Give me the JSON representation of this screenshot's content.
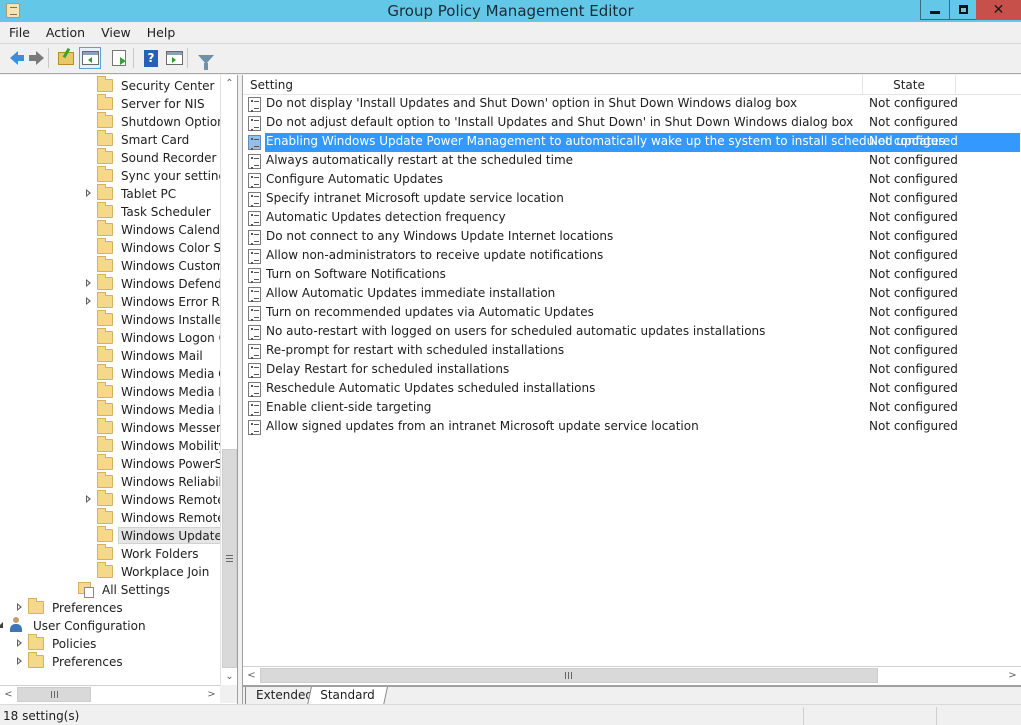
{
  "window": {
    "title": "Group Policy Management Editor",
    "minimize_label": "minimize",
    "restore_label": "restore",
    "close_glyph": "✕"
  },
  "menu": [
    "File",
    "Action",
    "View",
    "Help"
  ],
  "toolbar": {
    "buttons": [
      {
        "name": "back",
        "icon": "arrow-left-icon"
      },
      {
        "name": "forward",
        "icon": "arrow-right-icon"
      },
      {
        "name": "up-one-level",
        "icon": "folder-up-icon"
      },
      {
        "name": "show-hide-console-tree",
        "icon": "pane-icon",
        "active": true
      },
      {
        "name": "export-list",
        "icon": "export-icon"
      },
      {
        "name": "help",
        "icon": "help-icon"
      },
      {
        "name": "show-hide-action-pane",
        "icon": "pane-icon"
      },
      {
        "name": "filter",
        "icon": "filter-icon"
      }
    ],
    "help_glyph": "?"
  },
  "tree": {
    "items": [
      {
        "label": "Security Center",
        "level": 3,
        "expander": "none"
      },
      {
        "label": "Server for NIS",
        "level": 3,
        "expander": "none"
      },
      {
        "label": "Shutdown Options",
        "level": 3,
        "expander": "none"
      },
      {
        "label": "Smart Card",
        "level": 3,
        "expander": "none"
      },
      {
        "label": "Sound Recorder",
        "level": 3,
        "expander": "none"
      },
      {
        "label": "Sync your settings",
        "level": 3,
        "expander": "none"
      },
      {
        "label": "Tablet PC",
        "level": 3,
        "expander": "collapsed"
      },
      {
        "label": "Task Scheduler",
        "level": 3,
        "expander": "none"
      },
      {
        "label": "Windows Calendar",
        "level": 3,
        "expander": "none"
      },
      {
        "label": "Windows Color System",
        "level": 3,
        "expander": "none"
      },
      {
        "label": "Windows Customer Experience Improvement Program",
        "level": 3,
        "expander": "none"
      },
      {
        "label": "Windows Defender",
        "level": 3,
        "expander": "collapsed"
      },
      {
        "label": "Windows Error Reporting",
        "level": 3,
        "expander": "collapsed"
      },
      {
        "label": "Windows Installer",
        "level": 3,
        "expander": "none"
      },
      {
        "label": "Windows Logon Options",
        "level": 3,
        "expander": "none"
      },
      {
        "label": "Windows Mail",
        "level": 3,
        "expander": "none"
      },
      {
        "label": "Windows Media Center",
        "level": 3,
        "expander": "none"
      },
      {
        "label": "Windows Media Digital Rights Management",
        "level": 3,
        "expander": "none"
      },
      {
        "label": "Windows Media Player",
        "level": 3,
        "expander": "none"
      },
      {
        "label": "Windows Messenger",
        "level": 3,
        "expander": "none"
      },
      {
        "label": "Windows Mobility Center",
        "level": 3,
        "expander": "none"
      },
      {
        "label": "Windows PowerShell",
        "level": 3,
        "expander": "none"
      },
      {
        "label": "Windows Reliability Analysis",
        "level": 3,
        "expander": "none"
      },
      {
        "label": "Windows Remote Management (WinRM)",
        "level": 3,
        "expander": "collapsed"
      },
      {
        "label": "Windows Remote Shell",
        "level": 3,
        "expander": "none"
      },
      {
        "label": "Windows Update",
        "level": 3,
        "expander": "none",
        "selected": true
      },
      {
        "label": "Work Folders",
        "level": 3,
        "expander": "none"
      },
      {
        "label": "Workplace Join",
        "level": 3,
        "expander": "none"
      },
      {
        "label": "All Settings",
        "level": 2,
        "expander": "none",
        "icon": "all-settings"
      },
      {
        "label": "Preferences",
        "level": 1,
        "expander": "collapsed"
      },
      {
        "label": "User Configuration",
        "level": 0,
        "expander": "expanded",
        "icon": "user"
      },
      {
        "label": "Policies",
        "level": 1,
        "expander": "collapsed"
      },
      {
        "label": "Preferences",
        "level": 1,
        "expander": "collapsed"
      }
    ],
    "vscroll": {
      "up": "^",
      "down": "v",
      "thumb_position_pct": 62,
      "thumb_size_pct": 38
    },
    "hscroll": {
      "left": "<",
      "right": ">",
      "thumb_position_pct": 0,
      "thumb_size_pct": 40
    }
  },
  "list": {
    "columns": {
      "setting": "Setting",
      "state": "State"
    },
    "rows": [
      {
        "setting": "Do not display 'Install Updates and Shut Down' option in Shut Down Windows dialog box",
        "state": "Not configured"
      },
      {
        "setting": "Do not adjust default option to 'Install Updates and Shut Down' in Shut Down Windows dialog box",
        "state": "Not configured"
      },
      {
        "setting": "Enabling Windows Update Power Management to automatically wake up the system to install scheduled updates",
        "state": "Not configured",
        "selected": true
      },
      {
        "setting": "Always automatically restart at the scheduled time",
        "state": "Not configured"
      },
      {
        "setting": "Configure Automatic Updates",
        "state": "Not configured"
      },
      {
        "setting": "Specify intranet Microsoft update service location",
        "state": "Not configured"
      },
      {
        "setting": "Automatic Updates detection frequency",
        "state": "Not configured"
      },
      {
        "setting": "Do not connect to any Windows Update Internet locations",
        "state": "Not configured"
      },
      {
        "setting": "Allow non-administrators to receive update notifications",
        "state": "Not configured"
      },
      {
        "setting": "Turn on Software Notifications",
        "state": "Not configured"
      },
      {
        "setting": "Allow Automatic Updates immediate installation",
        "state": "Not configured"
      },
      {
        "setting": "Turn on recommended updates via Automatic Updates",
        "state": "Not configured"
      },
      {
        "setting": "No auto-restart with logged on users for scheduled automatic updates installations",
        "state": "Not configured"
      },
      {
        "setting": "Re-prompt for restart with scheduled installations",
        "state": "Not configured"
      },
      {
        "setting": "Delay Restart for scheduled installations",
        "state": "Not configured"
      },
      {
        "setting": "Reschedule Automatic Updates scheduled installations",
        "state": "Not configured"
      },
      {
        "setting": "Enable client-side targeting",
        "state": "Not configured"
      },
      {
        "setting": "Allow signed updates from an intranet Microsoft update service location",
        "state": "Not configured"
      }
    ],
    "hscroll": {
      "left": "<",
      "right": ">",
      "thumb_position_pct": 0,
      "thumb_size_pct": 83
    }
  },
  "view_tabs": [
    {
      "label": "Extended",
      "active": false
    },
    {
      "label": "Standard",
      "active": true
    }
  ],
  "status": {
    "text": "18 setting(s)"
  },
  "colors": {
    "titlebar": "#63c8e8",
    "selection": "#3399ff",
    "close": "#c7504a"
  }
}
